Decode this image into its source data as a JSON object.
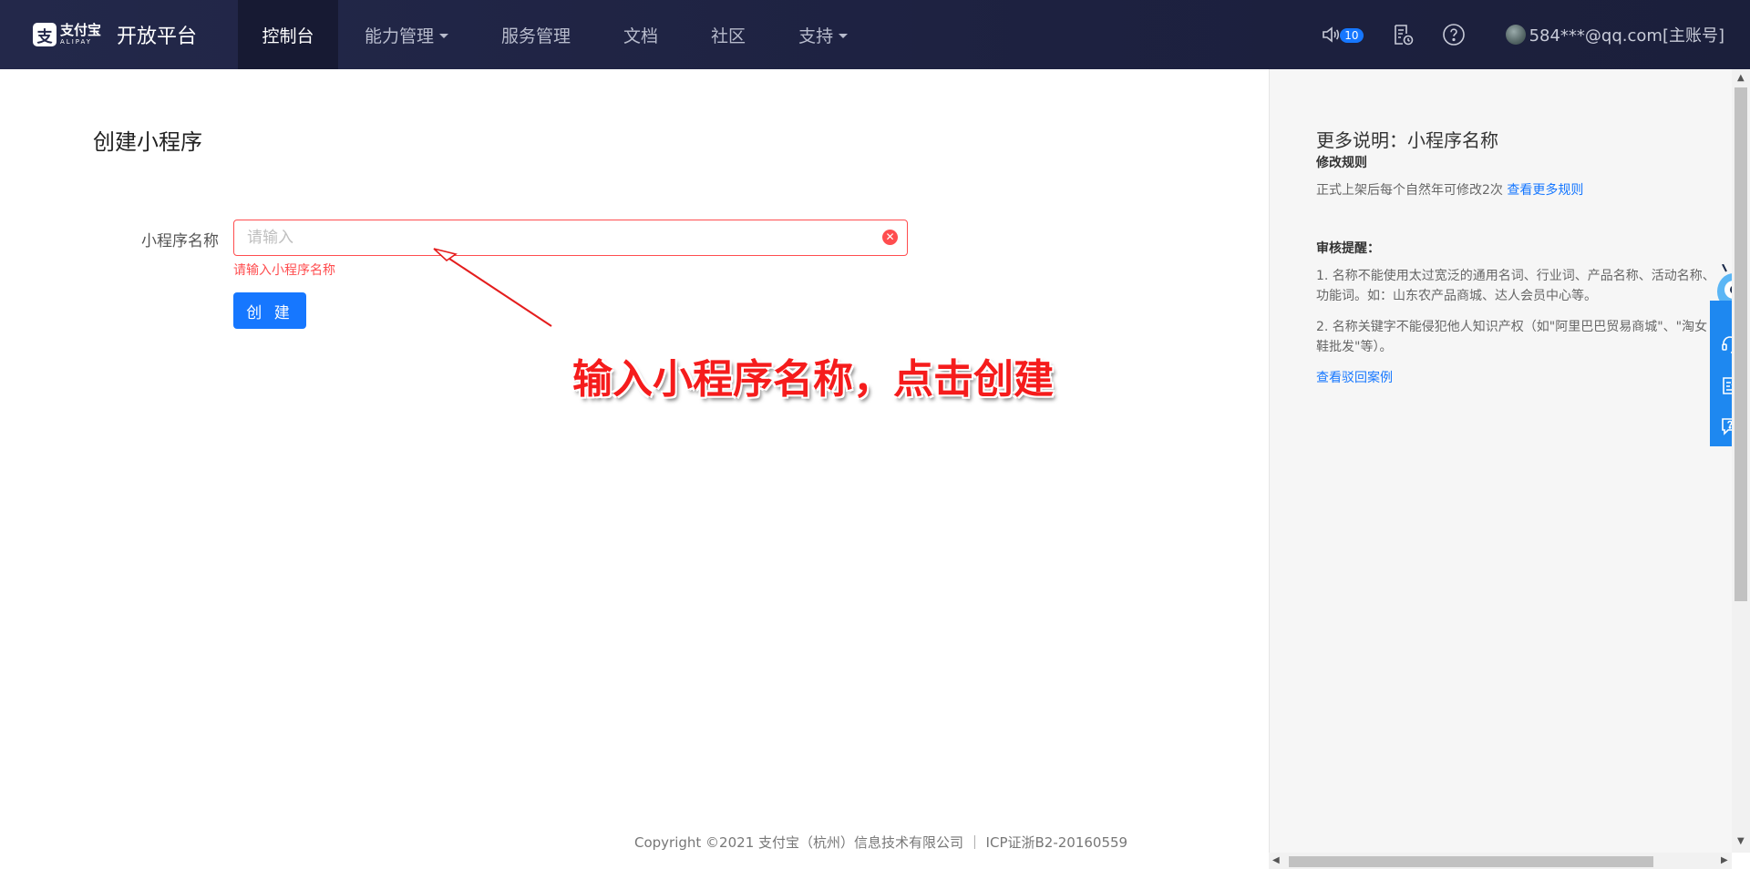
{
  "header": {
    "logo_cn": "支付宝",
    "logo_en": "ALIPAY",
    "platform": "开放平台",
    "nav": [
      {
        "label": "控制台",
        "active": true
      },
      {
        "label": "能力管理",
        "dropdown": true
      },
      {
        "label": "服务管理"
      },
      {
        "label": "文档"
      },
      {
        "label": "社区"
      },
      {
        "label": "支持",
        "dropdown": true
      }
    ],
    "notification_count": "10",
    "user": "584***@qq.com[主账号]"
  },
  "main": {
    "title": "创建小程序",
    "form": {
      "label": "小程序名称",
      "placeholder": "请输入",
      "error": "请输入小程序名称",
      "submit": "创 建"
    },
    "annotation": "输入小程序名称，点击创建"
  },
  "side_panel": {
    "title": "更多说明：小程序名称",
    "rules_heading": "修改规则",
    "rules_text": "正式上架后每个自然年可修改2次",
    "rules_link": "查看更多规则",
    "review_heading": "审核提醒：",
    "review_1": "1. 名称不能使用太过宽泛的通用名词、行业词、产品名称、活动名称、功能词。如：山东农产品商城、达人会员中心等。",
    "review_2": "2. 名称关键字不能侵犯他人知识产权（如\"阿里巴巴贸易商城\"、\"淘女鞋批发\"等）。",
    "review_link": "查看驳回案例"
  },
  "footer": "Copyright ©2021 支付宝（杭州）信息技术有限公司 ｜ ICP证浙B2-20160559",
  "colors": {
    "nav_bg": "#1d2140",
    "primary": "#1677ff",
    "error": "#ff4d4f",
    "annotation": "#f51c1c"
  }
}
